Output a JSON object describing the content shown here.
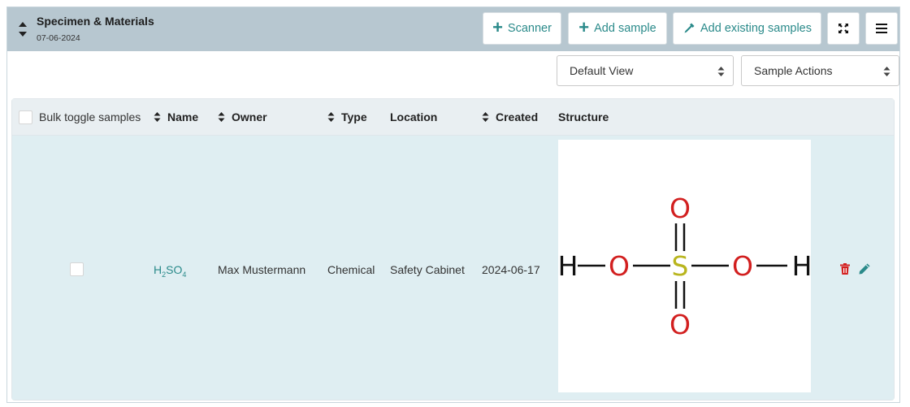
{
  "header": {
    "title": "Specimen & Materials",
    "date": "07-06-2024"
  },
  "toolbar": {
    "scanner_label": "Scanner",
    "add_sample_label": "Add sample",
    "add_existing_label": "Add existing samples",
    "expand_icon": "expand-icon",
    "menu_icon": "hamburger-icon"
  },
  "selects": {
    "view": "Default View",
    "actions": "Sample Actions"
  },
  "table": {
    "columns": {
      "bulk": "Bulk toggle samples",
      "name": "Name",
      "owner": "Owner",
      "type": "Type",
      "location": "Location",
      "created": "Created",
      "structure": "Structure"
    },
    "rows": [
      {
        "name_main": "H",
        "name_sub1": "2",
        "name_mid": "SO",
        "name_sub2": "4",
        "owner": "Max Mustermann",
        "type": "Chemical",
        "location": "Safety Cabinet",
        "created": "2024-06-17"
      }
    ]
  },
  "structure": {
    "atoms": {
      "h_left": "H",
      "o_left": "O",
      "s": "S",
      "o_right": "O",
      "h_right": "H",
      "o_top": "O",
      "o_bottom": "O"
    }
  },
  "colors": {
    "accent": "#2a8a8a",
    "header_bg": "#b7c7d0",
    "row_bg": "#dfeef2",
    "oxygen": "#d21f1f",
    "sulfur": "#b9b51e",
    "delete": "#d32020"
  }
}
